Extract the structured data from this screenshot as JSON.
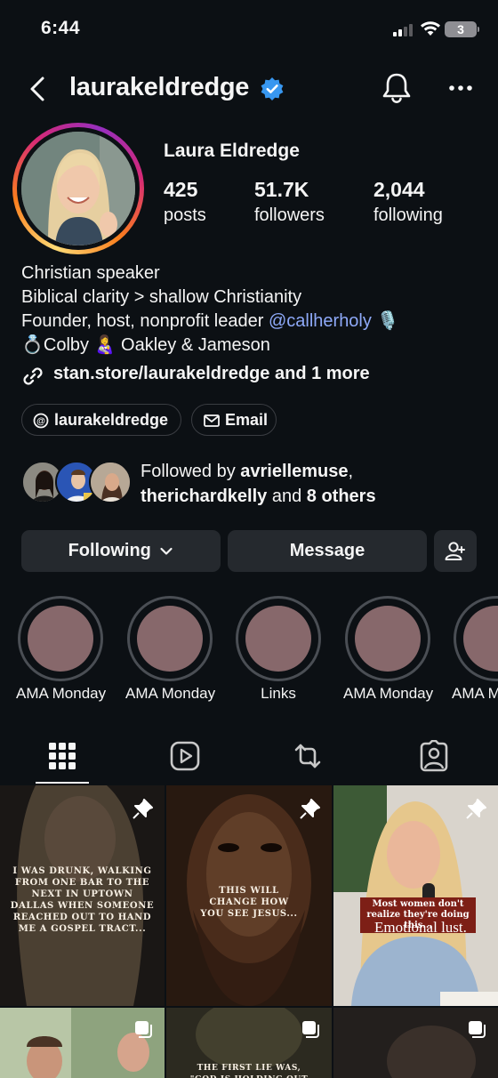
{
  "status_bar": {
    "time": "6:44",
    "battery": "3"
  },
  "header": {
    "username": "laurakeldredge"
  },
  "profile": {
    "display_name": "Laura Eldredge",
    "stats": [
      {
        "value": "425",
        "label": "posts"
      },
      {
        "value": "51.7K",
        "label": "followers"
      },
      {
        "value": "2,044",
        "label": "following"
      }
    ],
    "bio": {
      "line1": "Christian speaker",
      "line2": "Biblical clarity > shallow Christianity",
      "line3_text": "Founder, host, nonprofit leader ",
      "line3_mention": "@callherholy",
      "line3_emoji": "🎙️",
      "line4": "💍Colby 👩‍🍼 Oakley & Jameson"
    },
    "link": "stan.store/laurakeldredge and 1 more",
    "threads_label": "laurakeldredge",
    "email_label": "Email",
    "followed_by": {
      "prefix": "Followed by ",
      "user1": "avriellemuse",
      "sep": ",",
      "user2": "therichardkelly",
      "mid": " and ",
      "others": "8 others"
    }
  },
  "actions": {
    "following": "Following",
    "message": "Message"
  },
  "highlights": [
    {
      "label": "AMA Monday"
    },
    {
      "label": "AMA Monday"
    },
    {
      "label": "Links"
    },
    {
      "label": "AMA Monday"
    },
    {
      "label": "AMA M"
    }
  ],
  "tabs": [
    "grid-icon",
    "reels-icon",
    "reposts-icon",
    "tagged-icon"
  ],
  "posts": [
    {
      "text": "I was drunk, walking from one bar to the next in uptown Dallas when someone reached out to hand me a gospel tract..."
    },
    {
      "text": "This will change how you see Jesus..."
    },
    {
      "caption": "Most women don't realize they're doing this...",
      "caption2": "Emotional lust."
    },
    {
      "text": ""
    },
    {
      "text": "The first lie was, \"God is holding out on you\""
    },
    {
      "text": ""
    }
  ],
  "colors": {
    "background": "#0c1014",
    "button": "#25292e",
    "mention": "#8ea9f8",
    "verified": "#3897f0",
    "highlight_fill": "#87686b"
  }
}
